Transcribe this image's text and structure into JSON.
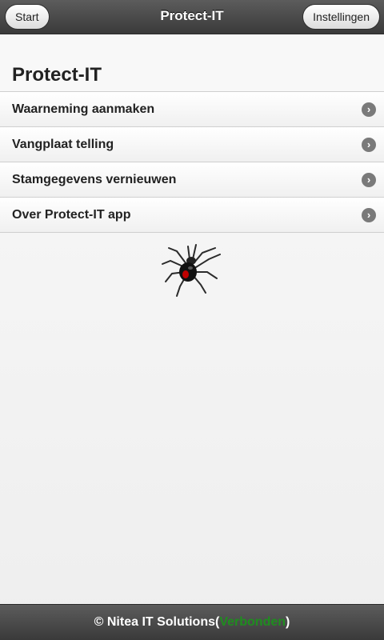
{
  "header": {
    "title": "Protect-IT",
    "start_label": "Start",
    "settings_label": "Instellingen"
  },
  "page": {
    "title": "Protect-IT"
  },
  "menu": {
    "items": [
      {
        "label": "Waarneming aanmaken"
      },
      {
        "label": "Vangplaat telling"
      },
      {
        "label": "Stamgegevens vernieuwen"
      },
      {
        "label": "Over Protect-IT app"
      }
    ]
  },
  "footer": {
    "text": "© Nitea IT Solutions(",
    "status": "Verbonden",
    "close": ")"
  },
  "colors": {
    "header_bg": "#3a3a3a",
    "status_connected": "#1f8d1f"
  },
  "icons": {
    "logo": "spider-icon",
    "menu_arrow": "chevron-right-icon"
  }
}
